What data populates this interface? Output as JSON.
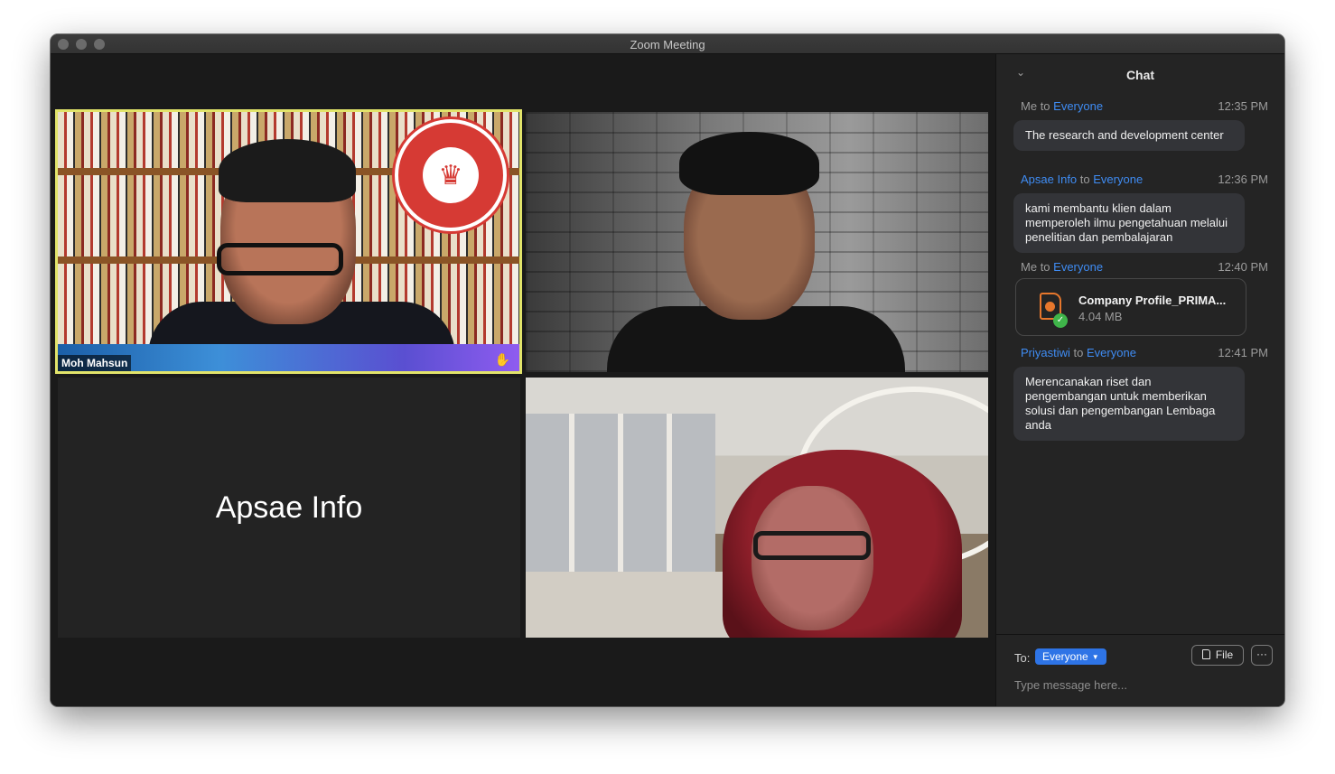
{
  "window": {
    "title": "Zoom Meeting"
  },
  "tiles": {
    "participant1": {
      "name": "Moh Mahsun"
    },
    "participant3": {
      "name": "Apsae Info"
    }
  },
  "chat": {
    "title": "Chat",
    "messages": [
      {
        "sender": "Me",
        "to_word": "to",
        "recipient": "Everyone",
        "time": "12:35 PM",
        "text": "The research and development center"
      },
      {
        "sender": "Apsae Info",
        "to_word": "to",
        "recipient": "Everyone",
        "time": "12:36 PM",
        "text": "kami membantu klien dalam memperoleh ilmu pengetahuan melalui penelitian dan pembalajaran"
      },
      {
        "sender": "Me",
        "to_word": "to",
        "recipient": "Everyone",
        "time": "12:40 PM",
        "file": {
          "name": "Company Profile_PRIMA...",
          "size": "4.04 MB"
        }
      },
      {
        "sender": "Priyastiwi",
        "to_word": "to",
        "recipient": "Everyone",
        "time": "12:41 PM",
        "text": "Merencanakan riset dan pengembangan untuk memberikan solusi dan pengembangan Lembaga anda"
      }
    ],
    "footer": {
      "to_label": "To:",
      "recipient": "Everyone",
      "file_button": "File",
      "more_button": "···",
      "input_placeholder": "Type message here..."
    }
  },
  "colors": {
    "accent": "#2e74e6",
    "link": "#3f8cf3",
    "active_speaker": "#e2e46a"
  },
  "icons": [
    "chevron-down-icon",
    "file-doc-icon",
    "check-icon",
    "caret-down-icon",
    "hand-icon"
  ]
}
